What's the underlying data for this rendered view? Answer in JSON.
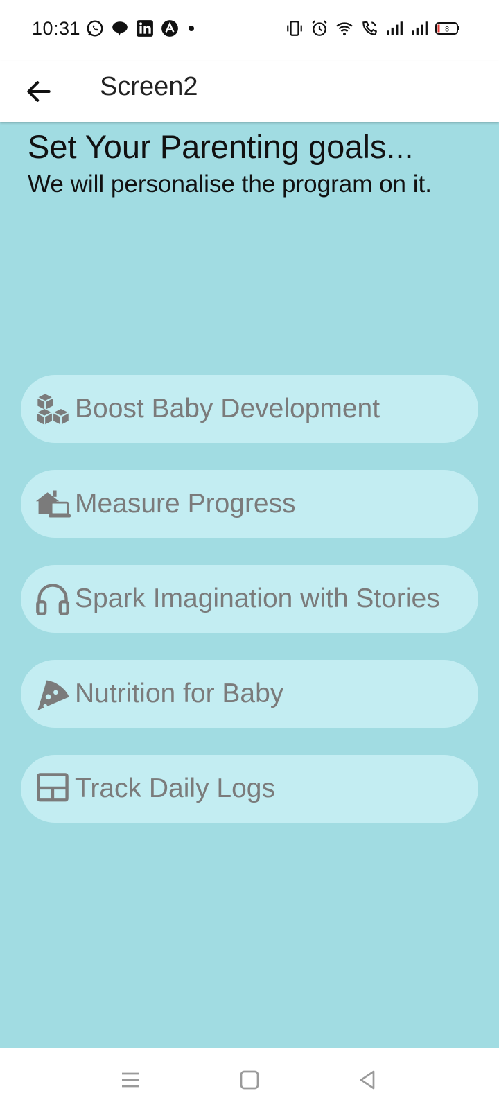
{
  "status_bar": {
    "time": "10:31",
    "battery": "8",
    "left_icons": [
      "whatsapp-icon",
      "chat-icon",
      "linkedin-icon",
      "notification-icon"
    ],
    "right_icons": [
      "vibrate-icon",
      "alarm-icon",
      "wifi-icon",
      "wifi-calling-icon",
      "signal-icon",
      "signal-icon",
      "battery-icon"
    ]
  },
  "app_bar": {
    "title": "Screen2",
    "back_icon": "arrow-left-icon"
  },
  "header": {
    "title": "Set Your Parenting goals...",
    "subtitle": "We will personalise the program on it."
  },
  "goals": [
    {
      "label": "Boost Baby Development",
      "icon": "blocks-icon"
    },
    {
      "label": "Measure Progress",
      "icon": "house-laptop-icon"
    },
    {
      "label": "Spark Imagination with Stories",
      "icon": "headphones-icon"
    },
    {
      "label": "Nutrition for Baby",
      "icon": "pizza-slice-icon"
    },
    {
      "label": "Track Daily Logs",
      "icon": "table-layout-icon"
    }
  ],
  "colors": {
    "background": "#a1dce2",
    "button": "#c3edf2",
    "button_text": "#7b7b7b"
  },
  "nav_bar": {
    "icons": [
      "menu-icon",
      "home-icon",
      "back-icon"
    ]
  }
}
